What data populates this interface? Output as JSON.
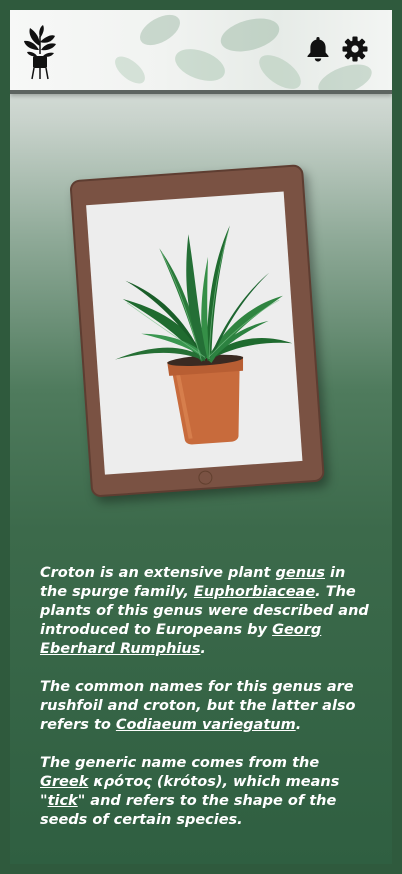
{
  "header": {
    "logo_icon": "plant-logo-icon",
    "notifications_icon": "bell-icon",
    "settings_icon": "gear-icon"
  },
  "hero": {
    "device": "tablet",
    "image_subject": "potted plant"
  },
  "paragraphs": {
    "p1": {
      "t1": "Croton is an extensive plant ",
      "link1": "genus",
      "t2": " in the spurge family, ",
      "link2": "Euphorbiaceae",
      "t3": ". The plants of this genus were described and introduced to Europeans by ",
      "link3": "Georg Eberhard Rumphius",
      "t4": "."
    },
    "p2": {
      "t1": "The common names for this genus are rushfoil and croton, but the latter also refers to ",
      "link1": "Codiaeum variegatum",
      "t2": "."
    },
    "p3": {
      "t1": " The generic name comes from the ",
      "link1": "Greek",
      "t2": " κρότος (krótos), which means \"",
      "link2": "tick",
      "t3": "\" and refers to the shape of the seeds of certain species."
    }
  },
  "colors": {
    "page_background": "#2f5a3d",
    "tablet_frame": "#7a5243",
    "text": "#ffffff"
  }
}
